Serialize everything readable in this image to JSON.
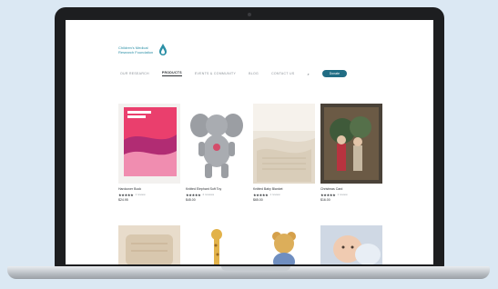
{
  "logo": {
    "text": "Children's Medical Research Foundation"
  },
  "nav": {
    "items": [
      {
        "label": "Our Research",
        "active": false
      },
      {
        "label": "Products",
        "active": true
      },
      {
        "label": "Events & Community",
        "active": false
      },
      {
        "label": "Blog",
        "active": false
      },
      {
        "label": "Contact Us",
        "active": false
      }
    ],
    "search_icon": "search-icon",
    "button_label": "Donate"
  },
  "products": [
    {
      "name": "Hardcover Book",
      "stars": "★★★★★",
      "reviews": "1 review",
      "price": "$24.95",
      "theme": "book"
    },
    {
      "name": "Knitted Elephant Soft Toy",
      "stars": "★★★★★",
      "reviews": "2 reviews",
      "price": "$45.00",
      "theme": "elephant"
    },
    {
      "name": "Knitted Baby Blanket",
      "stars": "★★★★★",
      "reviews": "1 review",
      "price": "$65.00",
      "theme": "blanket"
    },
    {
      "name": "Christmas Card",
      "stars": "★★★★★",
      "reviews": "1 review",
      "price": "$16.00",
      "theme": "card"
    },
    {
      "name": "",
      "stars": "",
      "reviews": "",
      "price": "",
      "theme": "baby-item"
    },
    {
      "name": "",
      "stars": "",
      "reviews": "",
      "price": "",
      "theme": "giraffe"
    },
    {
      "name": "",
      "stars": "",
      "reviews": "",
      "price": "",
      "theme": "bear"
    },
    {
      "name": "",
      "stars": "",
      "reviews": "",
      "price": "",
      "theme": "baby"
    }
  ],
  "colors": {
    "accent": "#216d84",
    "page_bg": "#dbe8f3"
  }
}
